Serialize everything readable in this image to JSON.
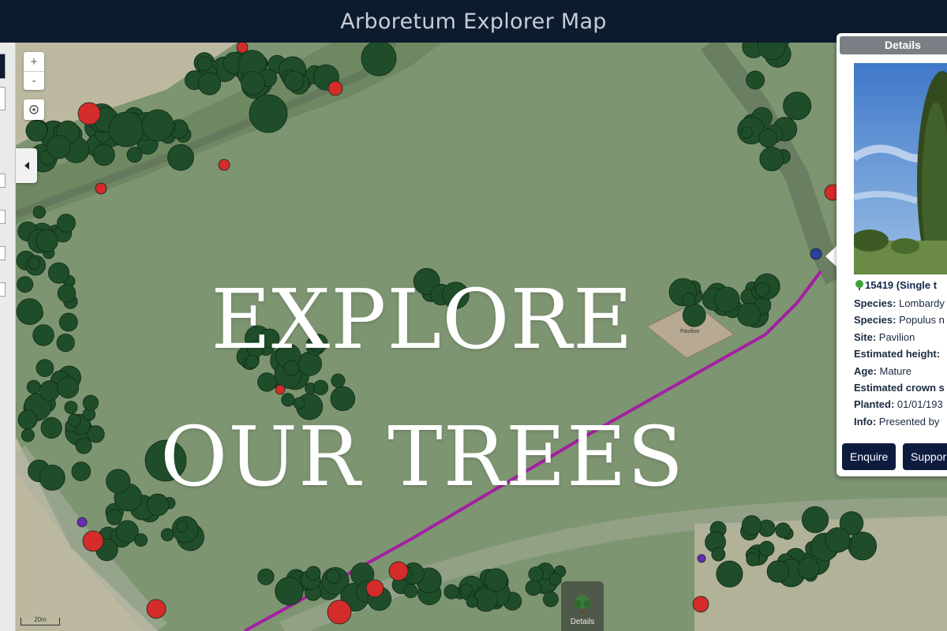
{
  "header": {
    "title": "Arboretum Explorer Map"
  },
  "overlay": {
    "line1": "EXPLORE",
    "line2": "OUR TREES"
  },
  "map_controls": {
    "zoom_in": "+",
    "zoom_out": "-",
    "locate_icon": "crosshair-icon",
    "collapse_icon": "chevron-left-icon"
  },
  "details_button": {
    "label": "Details",
    "icon": "tree-icon"
  },
  "scale_bar": {
    "label": "20m"
  },
  "details_panel": {
    "title": "Details",
    "tree_icon": "tree-icon",
    "tree_id": "15419 (Single t",
    "rows": [
      {
        "label": "Species:",
        "value": " Lombardy"
      },
      {
        "label": "Species:",
        "value": " Populus n"
      },
      {
        "label": "Site:",
        "value": " Pavilion"
      },
      {
        "label": "Estimated height:",
        "value": ""
      },
      {
        "label": "Age:",
        "value": " Mature"
      },
      {
        "label": "Estimated crown s",
        "value": ""
      },
      {
        "label": "Planted:",
        "value": " 01/01/193"
      },
      {
        "label": "Info:",
        "value": " Presented by"
      }
    ],
    "buttons": {
      "enquire": "Enquire",
      "support": "Suppor"
    }
  },
  "map_labels": {
    "pavilion": "Pavilion"
  },
  "colors": {
    "header_bg": "#0d1b2e",
    "map_grass": "#7e9572",
    "tree_canopy": "#1f4d2a",
    "veteran_tree": "#d42b2b",
    "special_tree": "#6a2bb5",
    "path_line": "#a31fa3",
    "button_bg": "#0d1b3e"
  }
}
